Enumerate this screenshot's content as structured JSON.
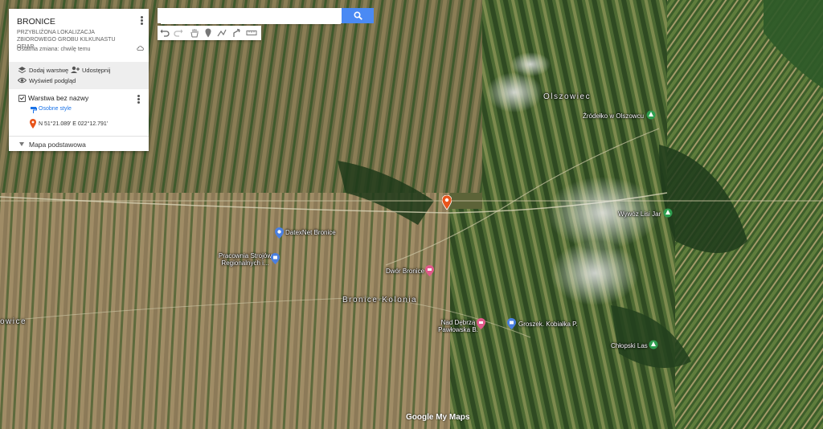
{
  "panel": {
    "title": "BRONICE",
    "description": "PRZYBLIŻONA LOKALIZACJA ZBIOROWEGO GROBU KILKUNASTU OFIAR",
    "last_changed": "Ostatnia zmiana: chwilę temu",
    "add_layer": "Dodaj warstwę",
    "share": "Udostępnij",
    "preview": "Wyświetl podgląd",
    "layer_name": "Warstwa bez nazwy",
    "layer_style": "Osobne style",
    "point_coords": "N 51°21.089' E 022°12.791'",
    "base_map": "Mapa podstawowa"
  },
  "search": {
    "value": "",
    "placeholder": ""
  },
  "map_labels": {
    "olszowiec": "Olszowiec",
    "zrodelko": "Źródełko w Olszowcu",
    "wywoz": "Wywóz Lisi Jar",
    "datexnet": "DatexNet Bronice",
    "pracownia": "Pracownia Strojów Regionalnych i...",
    "dwor": "Dwór Bronice",
    "bronice_kolonia": "Bronice-Kolonia",
    "nad_debrza": "Nad Dębrzą Pawłowska B.",
    "groszek": "Groszek. Kobiałka P.",
    "chlopski": "Chłopski Las",
    "left_edge": "owice"
  },
  "attribution": "Google My Maps",
  "colors": {
    "marker_orange": "#e8541a",
    "poi_blue": "#4a7fe0",
    "poi_pink": "#e05a8a",
    "poi_green": "#2e9e4f",
    "search_blue": "#4a8af4",
    "link_blue": "#1a73e8"
  }
}
